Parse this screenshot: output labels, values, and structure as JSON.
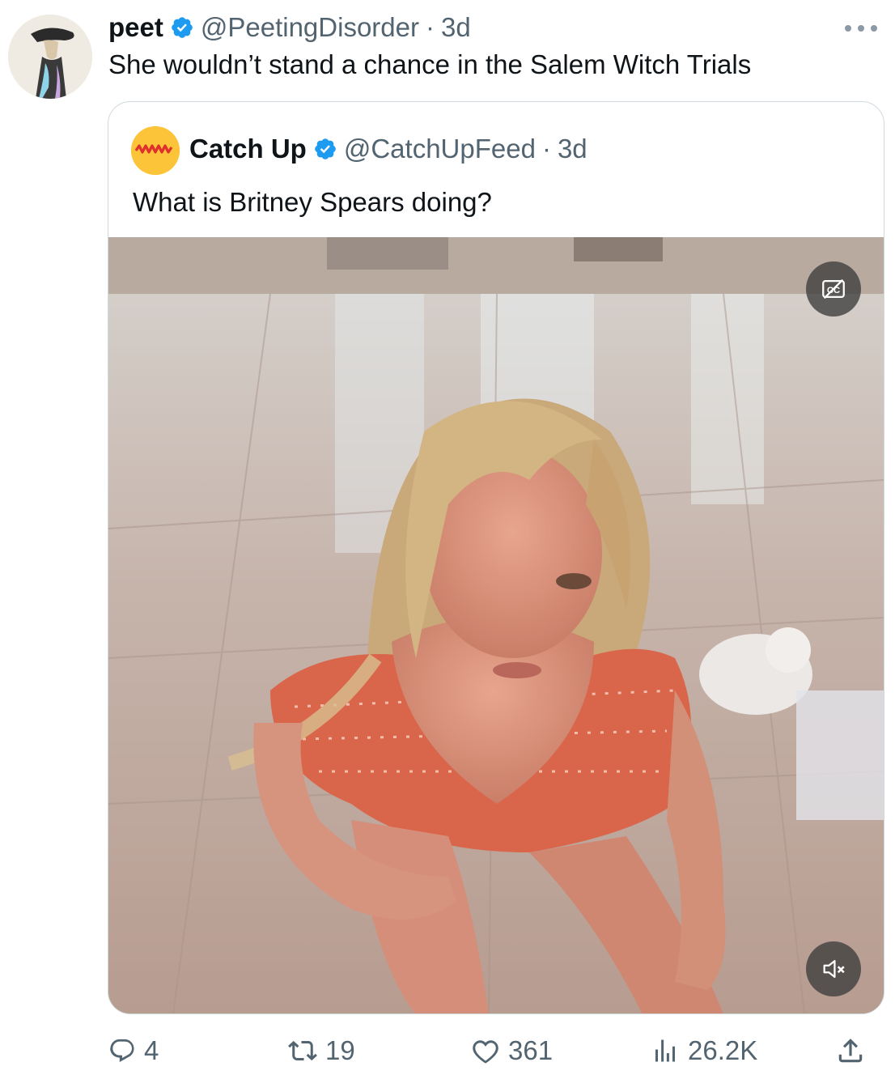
{
  "tweet": {
    "display_name": "peet",
    "handle": "@PeetingDisorder",
    "separator": "·",
    "time": "3d",
    "text": "She wouldn’t stand a chance in the Salem Witch Trials",
    "verified_color": "#1d9bf0"
  },
  "quoted": {
    "display_name": "Catch Up",
    "handle": "@CatchUpFeed",
    "separator": "·",
    "time": "3d",
    "text": "What is Britney Spears doing?",
    "avatar_color": "#fcc439",
    "media_controls": [
      "cc-icon",
      "mute-icon"
    ]
  },
  "actions": {
    "replies": "4",
    "reposts": "19",
    "likes": "361",
    "views": "26.2K"
  },
  "icons": [
    "verified-badge-icon",
    "more-icon",
    "reply-icon",
    "repost-icon",
    "like-icon",
    "views-icon",
    "share-icon"
  ]
}
